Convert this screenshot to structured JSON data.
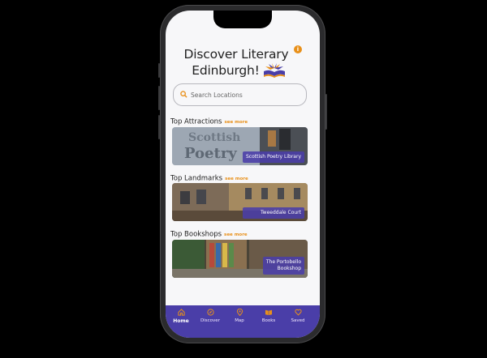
{
  "header": {
    "title_line1": "Discover Literary",
    "title_line2": "Edinburgh!",
    "info_glyph": "i"
  },
  "search": {
    "placeholder": "Search Locations"
  },
  "sections": [
    {
      "title": "Top Attractions",
      "see_more": "see more",
      "card_label": "Scottish Poetry Library"
    },
    {
      "title": "Top Landmarks",
      "see_more": "see more",
      "card_label": "Tweeddale Court"
    },
    {
      "title": "Top Bookshops",
      "see_more": "see more",
      "card_label_line1": "The Portobello",
      "card_label_line2": "Bookshop"
    }
  ],
  "tabbar": {
    "items": [
      {
        "label": "Home",
        "icon": "home-icon",
        "active": true
      },
      {
        "label": "Discover",
        "icon": "compass-icon",
        "active": false
      },
      {
        "label": "Map",
        "icon": "map-pin-icon",
        "active": false
      },
      {
        "label": "Books",
        "icon": "book-icon",
        "active": false
      },
      {
        "label": "Saved",
        "icon": "heart-icon",
        "active": false
      }
    ]
  },
  "colors": {
    "accent": "#4a3ea8",
    "orange": "#e8901a",
    "background": "#f7f7f9"
  }
}
